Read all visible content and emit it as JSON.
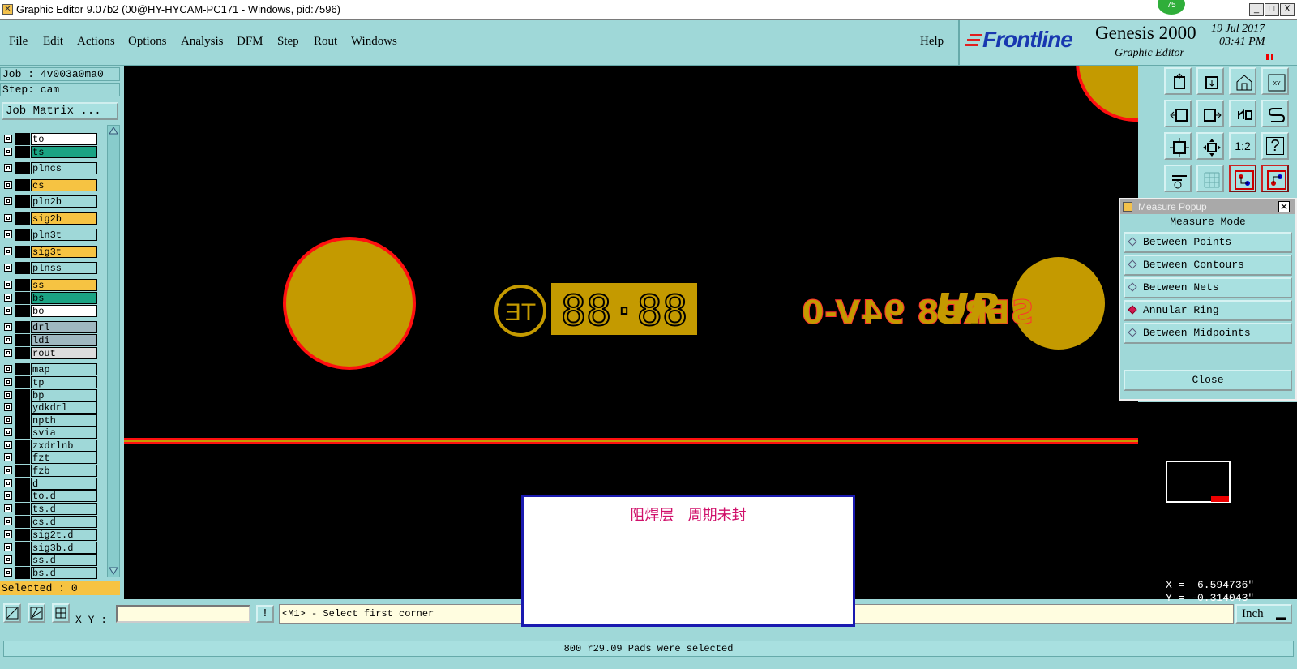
{
  "window": {
    "title": "Graphic Editor 9.07b2 (00@HY-HYCAM-PC171 - Windows, pid:7596)",
    "badge": "75",
    "min_label": "_",
    "max_label": "□",
    "close_label": "X"
  },
  "menu": {
    "items": [
      "File",
      "Edit",
      "Actions",
      "Options",
      "Analysis",
      "DFM",
      "Step",
      "Rout",
      "Windows"
    ],
    "help": "Help"
  },
  "brand": {
    "frontline": "Frontline",
    "product": "Genesis 2000",
    "subtitle": "Graphic Editor",
    "date": "19 Jul 2017",
    "time": "03:41 PM"
  },
  "job": {
    "job_text": "Job : 4v003a0ma0",
    "step_text": "Step: cam",
    "matrix_button": "Job Matrix ...",
    "selected_text": "Selected : 0"
  },
  "layers": [
    {
      "name": "to",
      "color": "#ffffff"
    },
    {
      "name": "ts",
      "color": "#1aa383"
    },
    {
      "name": "plncs",
      "color": "#9fd8d8"
    },
    {
      "name": "cs",
      "color": "#f6c342"
    },
    {
      "name": "pln2b",
      "color": "#9fd8d8"
    },
    {
      "name": "sig2b",
      "color": "#f6c342"
    },
    {
      "name": "pln3t",
      "color": "#9fd8d8"
    },
    {
      "name": "sig3t",
      "color": "#f6c342"
    },
    {
      "name": "plnss",
      "color": "#9fd8d8"
    },
    {
      "name": "ss",
      "color": "#f6c342"
    },
    {
      "name": "bs",
      "color": "#1aa383",
      "dot": "#22a022"
    },
    {
      "name": "bo",
      "color": "#ffffff"
    },
    {
      "name": "drl",
      "color": "#9fb8c0"
    },
    {
      "name": "ldi",
      "color": "#9fb8c0"
    },
    {
      "name": "rout",
      "color": "#dddddd"
    },
    {
      "name": "map",
      "color": "#9fd8d8"
    },
    {
      "name": "tp",
      "color": "#9fd8d8"
    },
    {
      "name": "bp",
      "color": "#9fd8d8"
    },
    {
      "name": "ydkdrl",
      "color": "#9fd8d8"
    },
    {
      "name": "npth",
      "color": "#9fd8d8"
    },
    {
      "name": "svia",
      "color": "#9fd8d8"
    },
    {
      "name": "zxdrlnb",
      "color": "#9fd8d8"
    },
    {
      "name": "fzt",
      "color": "#9fd8d8"
    },
    {
      "name": "fzb",
      "color": "#9fd8d8"
    },
    {
      "name": "d",
      "color": "#9fd8d8"
    },
    {
      "name": "to.d",
      "color": "#9fd8d8"
    },
    {
      "name": "ts.d",
      "color": "#9fd8d8"
    },
    {
      "name": "cs.d",
      "color": "#9fd8d8"
    },
    {
      "name": "sig2t.d",
      "color": "#9fd8d8"
    },
    {
      "name": "sig3b.d",
      "color": "#9fd8d8"
    },
    {
      "name": "ss.d",
      "color": "#9fd8d8"
    },
    {
      "name": "bs.d",
      "color": "#9fd8d8",
      "dot": "#e00000"
    }
  ],
  "canvas": {
    "mirrored_text": "SERP8 94V-0",
    "digits_text": "88·88",
    "te_text": "TE",
    "ur_text": "UR",
    "copper_color": "#c49a00",
    "outline_color": "#ff1010"
  },
  "toolbar": {
    "icons": [
      "load-icon",
      "save-icon",
      "home-icon",
      "fit-icon",
      "left-icon",
      "right-icon",
      "undo-icon",
      "snap-icon",
      "zoom-fit-icon",
      "pan-icon",
      "ratio-icon",
      "help-icon",
      "tool-icon",
      "grid-icon",
      "layer-a-icon",
      "layer-b-icon"
    ],
    "ratio_label": "1:2",
    "help_label": "?"
  },
  "measure_popup": {
    "title": "Measure Popup",
    "mode_label": "Measure Mode",
    "options": [
      "Between Points",
      "Between Contours",
      "Between Nets",
      "Annular Ring",
      "Between Midpoints"
    ],
    "selected_option": "Annular Ring",
    "close_label": "Close"
  },
  "coords": {
    "x": "X =  6.594736\"",
    "y": "Y = -0.314043\""
  },
  "bottom": {
    "xy_label": "X Y :",
    "xy_value": "",
    "info_label": "!",
    "prompt": "<M1> - Select first corner",
    "unit": "Inch",
    "status": "800 r29.09 Pads were selected"
  },
  "note": {
    "text": "阻焊层   周期未封"
  }
}
